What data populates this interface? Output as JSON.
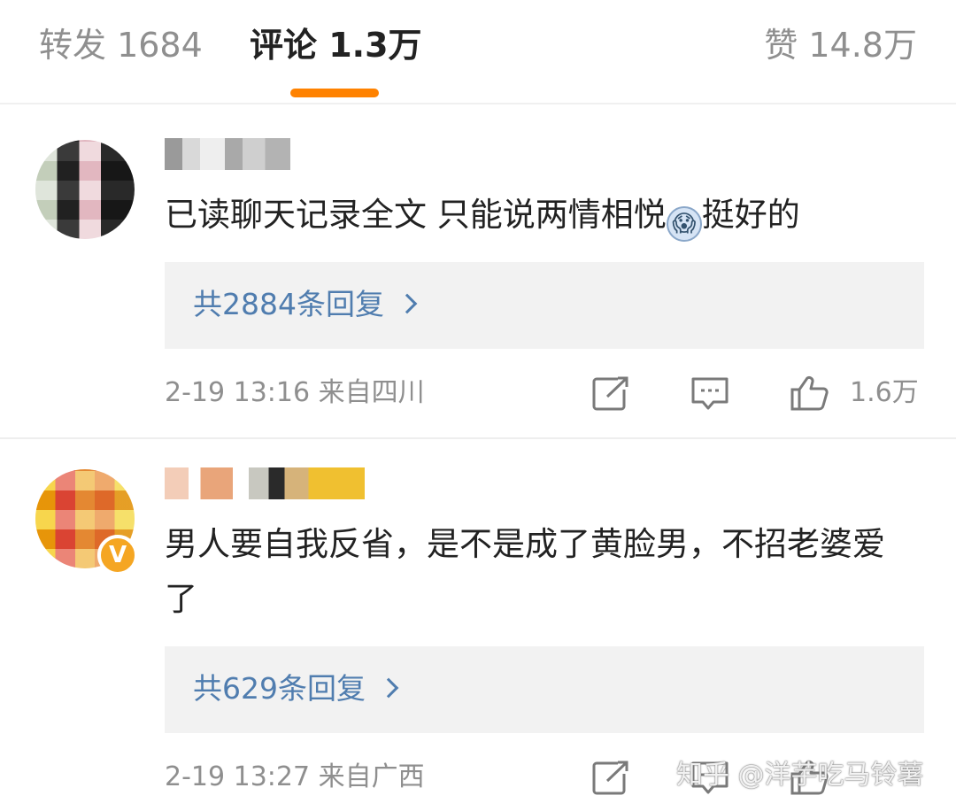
{
  "tabs": {
    "reposts": "转发 1684",
    "comments": "评论 1.3万",
    "likes": "赞 14.8万",
    "indicator_color": "#ff8200"
  },
  "comments": [
    {
      "text_before_emoji": "已读聊天记录全文 只能说两情相悦",
      "emoji": "😱",
      "text_after_emoji": "挺好的",
      "replies": "共2884条回复",
      "meta": "2-19 13:16 来自四川",
      "likes": "1.6万"
    },
    {
      "text": "男人要自我反省，是不是成了黄脸男，不招老婆爱了",
      "replies": "共629条回复",
      "meta": "2-19 13:27 来自广西",
      "verified_badge": "V"
    }
  ],
  "icons": [
    "share-icon",
    "reply-icon",
    "like-icon",
    "chevron-right-icon"
  ],
  "colors": {
    "link": "#507daf",
    "muted": "#8f8f8f",
    "reply_bg": "#f2f2f2"
  },
  "watermark": "知乎 @洋芋吃马铃薯"
}
